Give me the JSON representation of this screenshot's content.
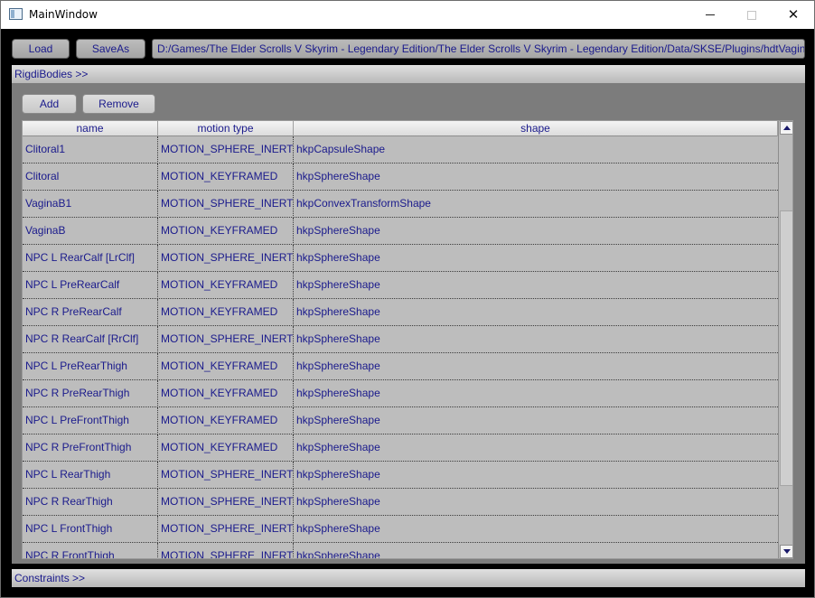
{
  "window": {
    "title": "MainWindow",
    "icons": {
      "app": "app-window-icon",
      "minimize": "minimize-icon",
      "maximize": "maximize-icon",
      "close": "close-icon"
    }
  },
  "toolbar": {
    "load_label": "Load",
    "saveas_label": "SaveAs",
    "path": "D:/Games/The Elder Scrolls V Skyrim - Legendary Edition/The Elder Scrolls V Skyrim - Legendary Edition/Data/SKSE/Plugins/hdtVagina.xml"
  },
  "rigid_bodies": {
    "header": "RigdiBodies >>",
    "add_label": "Add",
    "remove_label": "Remove",
    "columns": [
      "name",
      "motion type",
      "shape"
    ],
    "rows": [
      {
        "name": "Clitoral1",
        "motion": "MOTION_SPHERE_INERTIA",
        "shape": "hkpCapsuleShape"
      },
      {
        "name": "Clitoral",
        "motion": "MOTION_KEYFRAMED",
        "shape": "hkpSphereShape"
      },
      {
        "name": "VaginaB1",
        "motion": "MOTION_SPHERE_INERTIA",
        "shape": "hkpConvexTransformShape"
      },
      {
        "name": "VaginaB",
        "motion": "MOTION_KEYFRAMED",
        "shape": "hkpSphereShape"
      },
      {
        "name": "NPC L RearCalf [LrClf]",
        "motion": "MOTION_SPHERE_INERTIA",
        "shape": "hkpSphereShape"
      },
      {
        "name": "NPC L PreRearCalf",
        "motion": "MOTION_KEYFRAMED",
        "shape": "hkpSphereShape"
      },
      {
        "name": "NPC R PreRearCalf",
        "motion": "MOTION_KEYFRAMED",
        "shape": "hkpSphereShape"
      },
      {
        "name": "NPC R RearCalf [RrClf]",
        "motion": "MOTION_SPHERE_INERTIA",
        "shape": "hkpSphereShape"
      },
      {
        "name": "NPC L PreRearThigh",
        "motion": "MOTION_KEYFRAMED",
        "shape": "hkpSphereShape"
      },
      {
        "name": "NPC R PreRearThigh",
        "motion": "MOTION_KEYFRAMED",
        "shape": "hkpSphereShape"
      },
      {
        "name": "NPC L PreFrontThigh",
        "motion": "MOTION_KEYFRAMED",
        "shape": "hkpSphereShape"
      },
      {
        "name": "NPC R PreFrontThigh",
        "motion": "MOTION_KEYFRAMED",
        "shape": "hkpSphereShape"
      },
      {
        "name": "NPC L RearThigh",
        "motion": "MOTION_SPHERE_INERTIA",
        "shape": "hkpSphereShape"
      },
      {
        "name": "NPC R RearThigh",
        "motion": "MOTION_SPHERE_INERTIA",
        "shape": "hkpSphereShape"
      },
      {
        "name": "NPC L FrontThigh",
        "motion": "MOTION_SPHERE_INERTIA",
        "shape": "hkpSphereShape"
      },
      {
        "name": "NPC R FrontThigh",
        "motion": "MOTION_SPHERE_INERTIA",
        "shape": "hkpSphereShape"
      }
    ]
  },
  "constraints": {
    "header": "Constraints >>"
  },
  "colors": {
    "text": "#1a1a8c",
    "panel": "#7c7c7c",
    "table": "#bdbdbd",
    "frame": "#000000"
  }
}
